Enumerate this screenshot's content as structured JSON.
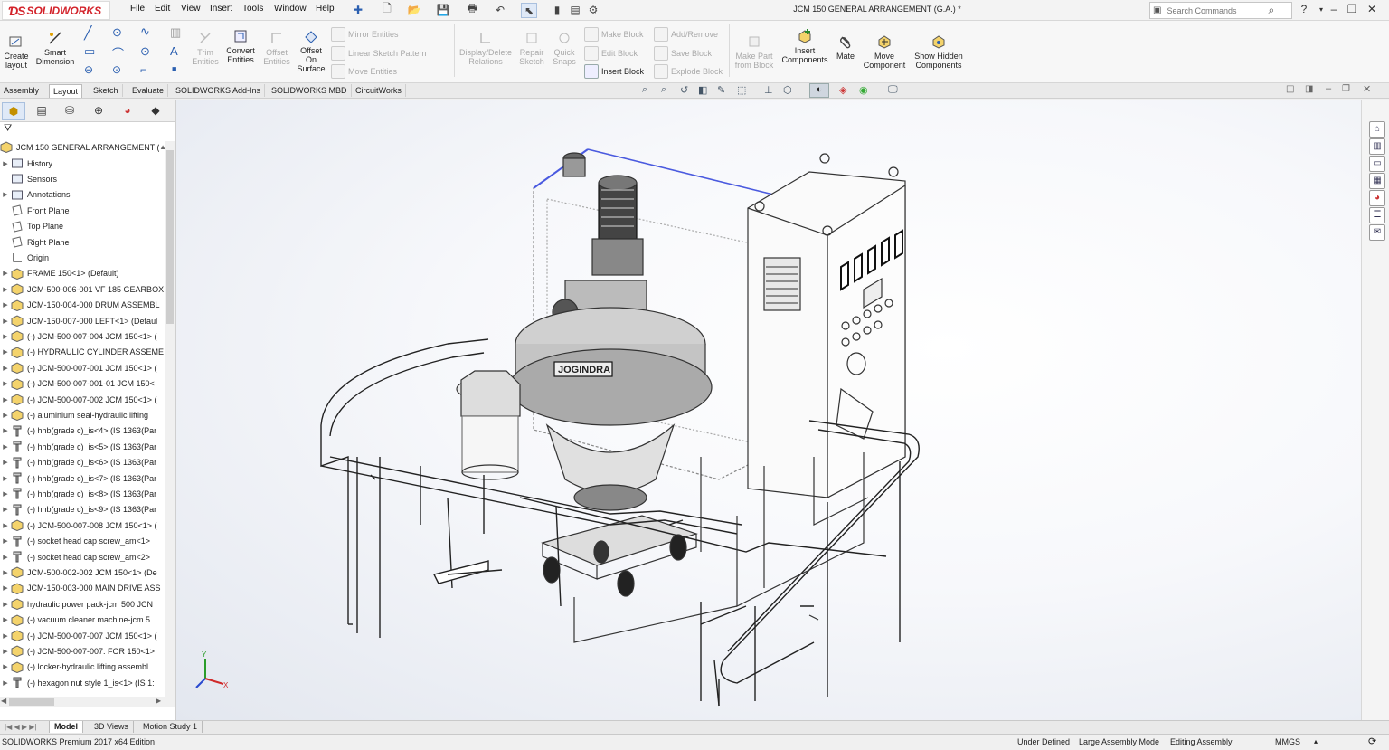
{
  "app": {
    "logo": "SOLIDWORKS"
  },
  "title": "JCM 150 GENERAL ARRANGEMENT (G.A.) *",
  "menu": [
    "File",
    "Edit",
    "View",
    "Insert",
    "Tools",
    "Window",
    "Help"
  ],
  "search": {
    "placeholder": "Search Commands"
  },
  "ribbon": {
    "create_layout": "Create layout",
    "smart_dimension": "Smart Dimension",
    "trim_entities": "Trim Entities",
    "convert_entities": "Convert Entities",
    "offset_entities": "Offset Entities",
    "offset_on_surface": "Offset On Surface",
    "mirror_entities": "Mirror Entities",
    "linear_sketch_pattern": "Linear Sketch Pattern",
    "move_entities": "Move Entities",
    "display_delete_relations": "Display/Delete Relations",
    "repair_sketch": "Repair Sketch",
    "quick_snaps": "Quick Snaps",
    "make_block": "Make Block",
    "edit_block": "Edit Block",
    "insert_block": "Insert Block",
    "add_remove": "Add/Remove",
    "save_block": "Save Block",
    "explode_block": "Explode Block",
    "make_part_from_block": "Make Part from Block",
    "insert_components": "Insert Components",
    "mate": "Mate",
    "move_component": "Move Component",
    "show_hidden_components": "Show Hidden Components"
  },
  "command_tabs": [
    "Assembly",
    "Layout",
    "Sketch",
    "Evaluate",
    "SOLIDWORKS Add-Ins",
    "SOLIDWORKS MBD",
    "CircuitWorks"
  ],
  "tree": {
    "root": "JCM 150 GENERAL ARRANGEMENT (G...",
    "items": [
      "History",
      "Sensors",
      "Annotations",
      "Front Plane",
      "Top Plane",
      "Right Plane",
      "Origin",
      "FRAME 150<1> (Default)",
      "JCM-500-006-001 VF 185 GEARBOX",
      "JCM-150-004-000 DRUM ASSEMBL",
      "JCM-150-007-000 LEFT<1> (Defaul",
      "(-) JCM-500-007-004 JCM 150<1> (",
      "(-) HYDRAULIC CYLINDER ASSEME",
      "(-) JCM-500-007-001 JCM 150<1> (",
      "(-) JCM-500-007-001-01 JCM 150<",
      "(-) JCM-500-007-002 JCM 150<1> (",
      "(-) aluminium seal-hydraulic lifting",
      "(-) hhb(grade c)_is<4> (IS 1363(Par",
      "(-) hhb(grade c)_is<5> (IS 1363(Par",
      "(-) hhb(grade c)_is<6> (IS 1363(Par",
      "(-) hhb(grade c)_is<7> (IS 1363(Par",
      "(-) hhb(grade c)_is<8> (IS 1363(Par",
      "(-) hhb(grade c)_is<9> (IS 1363(Par",
      "(-) JCM-500-007-008 JCM 150<1> (",
      "(-) socket head cap screw_am<1>",
      "(-) socket head cap screw_am<2>",
      "JCM-500-002-002 JCM 150<1> (De",
      "JCM-150-003-000 MAIN DRIVE ASS",
      "hydraulic power pack-jcm 500 JCN",
      "(-) vacuum cleaner machine-jcm 5",
      "(-) JCM-500-007-007 JCM 150<1> (",
      "(-) JCM-500-007-007. FOR 150<1>",
      "(-) locker-hydraulic lifting assembl",
      "(-) hexagon nut style 1_is<1> (IS 1:"
    ]
  },
  "model": {
    "brand_label": "JOGINDRA"
  },
  "bottom_tabs": [
    "Model",
    "3D Views",
    "Motion Study 1"
  ],
  "status": {
    "edition": "SOLIDWORKS Premium 2017 x64 Edition",
    "under_defined": "Under Defined",
    "large_assembly": "Large Assembly Mode",
    "editing": "Editing Assembly",
    "units": "MMGS"
  },
  "colors": {
    "brand": "#d3222a",
    "selection": "#dfe9f7"
  }
}
